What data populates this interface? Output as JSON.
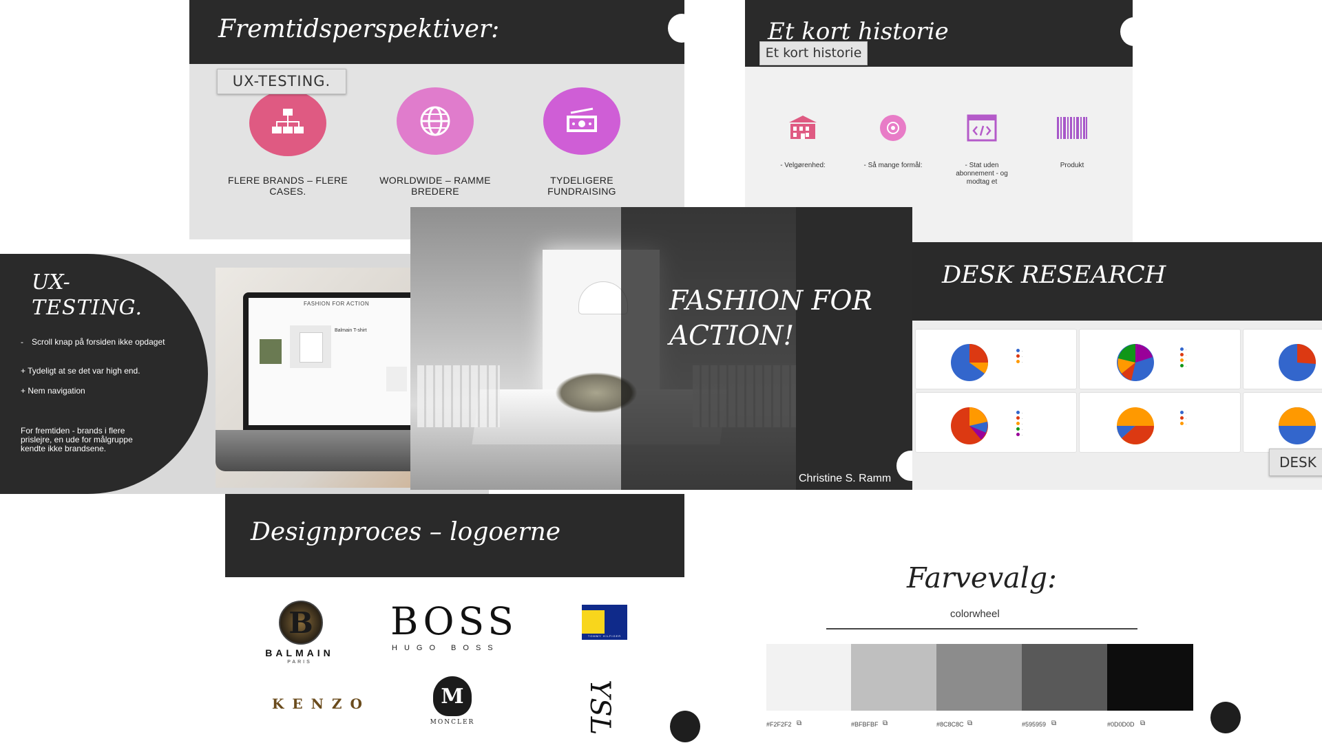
{
  "slide_future": {
    "title": "Fremtidsperspektiver:",
    "tooltip": "UX-TESTING.",
    "items": [
      {
        "label": "FLERE BRANDS – FLERE CASES."
      },
      {
        "label": "WORLDWIDE – RAMME BREDERE"
      },
      {
        "label": "TYDELIGERE FUNDRAISING"
      }
    ],
    "icon_colors": [
      "#df5a82",
      "#e07ccc",
      "#cf5ed6"
    ]
  },
  "slide_history": {
    "title": "Et kort historie",
    "tooltip": "Et kort historie",
    "items": [
      {
        "label": "- Velgørenhed:"
      },
      {
        "label": "- Så mange formål:"
      },
      {
        "label": "- Stat uden abonnement - og modtag et"
      },
      {
        "label": "Produkt"
      }
    ]
  },
  "slide_ux": {
    "title_line1": "UX-",
    "title_line2": "TESTING.",
    "bullets": [
      "Scroll knap på forsiden ikke opdaget",
      "+ Tydeligt at se det var high end.",
      "+ Nem navigation"
    ],
    "future_note": "For fremtiden - brands i flere prislejre, en ude for målgruppe kendte ikke brandsene.",
    "laptop_page_title": "FASHION FOR ACTION",
    "laptop_product": "Balmain T-shirt"
  },
  "slide_main": {
    "title_line1": "FASHION FOR",
    "title_line2": "ACTION!",
    "author": "Christine S. Ramm"
  },
  "slide_desk": {
    "title": "DESK RESEARCH",
    "tooltip": "DESK"
  },
  "slide_design": {
    "title": "Designproces – logoerne",
    "logos": {
      "balmain": "BALMAIN",
      "balmain_sub": "PARIS",
      "boss": "BOSS",
      "boss_sub": "HUGO BOSS",
      "kenzo": "KENZO",
      "moncler": "MONCLER",
      "tommy": "TOMMY HILFIGER",
      "ysl": "YSL"
    }
  },
  "slide_colors": {
    "title": "Farvevalg:",
    "subtitle": "colorwheel",
    "swatches": [
      {
        "color": "#F2F2F2",
        "label": "#F2F2F2"
      },
      {
        "color": "#BFBFBF",
        "label": "#BFBFBF"
      },
      {
        "color": "#8C8C8C",
        "label": "#8C8C8C"
      },
      {
        "color": "#595959",
        "label": "#595959"
      },
      {
        "color": "#0D0D0D",
        "label": "#0D0D0D"
      }
    ]
  }
}
